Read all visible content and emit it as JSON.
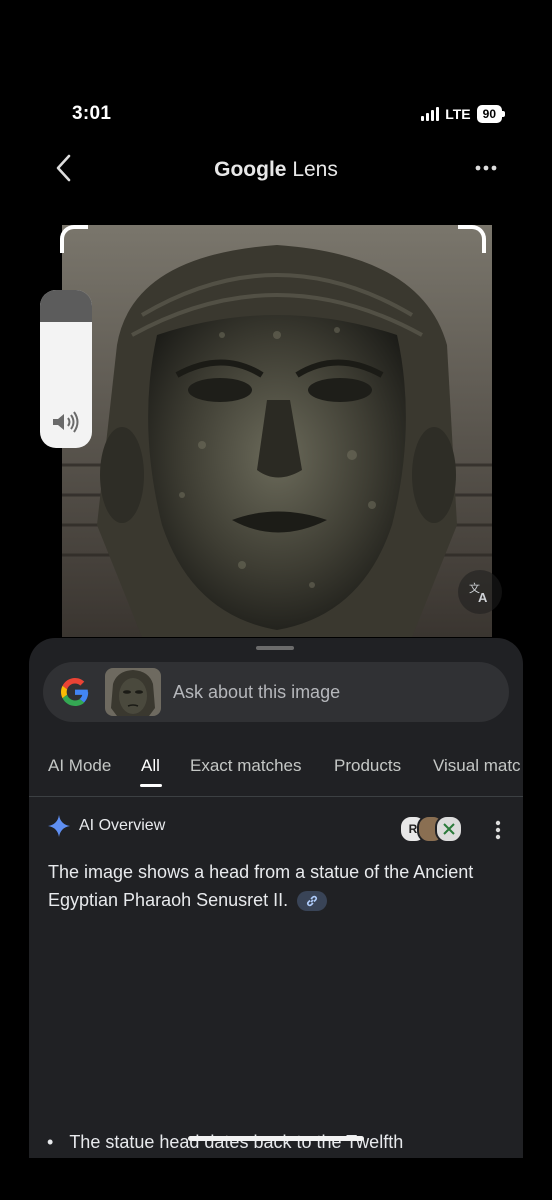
{
  "status_bar": {
    "time": "3:01",
    "network": "LTE",
    "battery": "90"
  },
  "header": {
    "title_brand": "Google",
    "title_product": "Lens",
    "back_icon": "chevron-left-icon",
    "more_icon": "more-horizontal-icon"
  },
  "volume_hud": {
    "level": 0.8,
    "icon": "speaker-icon"
  },
  "search": {
    "placeholder": "Ask about this image"
  },
  "tabs": [
    {
      "label": "AI Mode"
    },
    {
      "label": "All",
      "active": true
    },
    {
      "label": "Exact matches"
    },
    {
      "label": "Products"
    },
    {
      "label": "Visual matc"
    }
  ],
  "ai_overview": {
    "title": "AI Overview",
    "sources": [
      "R",
      "",
      ""
    ],
    "text": "The image shows a head from a statue of the Ancient Egyptian Pharaoh Senusret II.",
    "bullet": "The statue head dates back to the Twelfth"
  },
  "colors": {
    "background": "#000000",
    "sheet": "#202124",
    "search_bar": "#303134",
    "accent_blue": "#8ab4f8"
  }
}
